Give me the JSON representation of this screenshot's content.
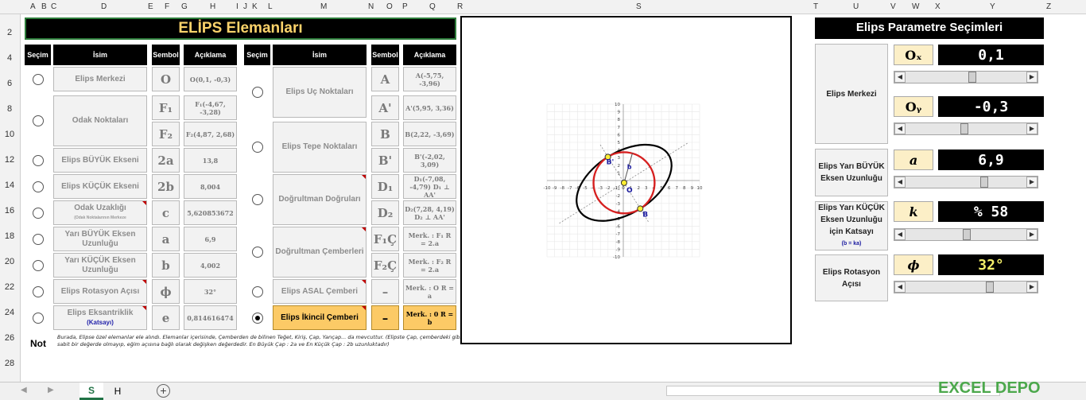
{
  "columns": [
    "A",
    "B",
    "C",
    "D",
    "E",
    "F",
    "G",
    "H",
    "I",
    "J",
    "K",
    "L",
    "M",
    "N",
    "O",
    "P",
    "Q",
    "R",
    "S",
    "T",
    "U",
    "V",
    "W",
    "X",
    "Y",
    "Z"
  ],
  "rows": [
    "2",
    "4",
    "6",
    "8",
    "10",
    "12",
    "14",
    "16",
    "18",
    "20",
    "22",
    "24",
    "26",
    "28"
  ],
  "left_title": "ELİPS Elemanları",
  "headers": {
    "secim": "Seçim",
    "isim": "İsim",
    "sembol": "Sembol",
    "aciklama": "Açıklama"
  },
  "left_items": [
    {
      "name": "Elips Merkezi",
      "symbol": "O",
      "desc": "O(0,1, -0,3)"
    },
    {
      "name": "Odak Noktaları",
      "symbol": "F₁",
      "desc": "F₁(-4,67, -3,28)"
    },
    {
      "name": "",
      "symbol": "F₂",
      "desc": "F₂(4,87, 2,68)"
    },
    {
      "name": "Elips BÜYÜK Ekseni",
      "symbol": "2a",
      "desc": "13,8"
    },
    {
      "name": "Elips KÜÇÜK Ekseni",
      "symbol": "2b",
      "desc": "8,004"
    },
    {
      "name": "Odak Uzaklığı",
      "sub": "(Odak Noktalarının Merkeze",
      "symbol": "c",
      "desc": "5,620853672"
    },
    {
      "name": "Yarı BÜYÜK Eksen Uzunluğu",
      "symbol": "a",
      "desc": "6,9"
    },
    {
      "name": "Yarı KÜÇÜK Eksen Uzunluğu",
      "symbol": "b",
      "desc": "4,002"
    },
    {
      "name": "Elips Rotasyon Açısı",
      "symbol": "ϕ",
      "desc": "32°"
    },
    {
      "name": "Elips Eksantriklik",
      "sub": "(Katsayı)",
      "symbol": "e",
      "desc": "0,814616474"
    }
  ],
  "right_items": [
    {
      "name": "Elips Uç Noktaları",
      "symbol": "A",
      "desc": "A(-5,75, -3,96)"
    },
    {
      "name": "",
      "symbol": "A'",
      "desc": "A'(5,95, 3,36)"
    },
    {
      "name": "Elips Tepe Noktaları",
      "symbol": "B",
      "desc": "B(2,22, -3,69)"
    },
    {
      "name": "",
      "symbol": "B'",
      "desc": "B'(-2,02, 3,09)"
    },
    {
      "name": "Doğrultman Doğruları",
      "symbol": "D₁",
      "desc": "D₁(-7,08, -4,79) D₁ ⊥ AA'"
    },
    {
      "name": "",
      "symbol": "D₂",
      "desc": "D₂(7,28, 4,19) D₂ ⊥ AA'"
    },
    {
      "name": "Doğrultman Çemberleri",
      "symbol": "F₁Ç",
      "desc": "Merk. : F₁ R = 2.a"
    },
    {
      "name": "",
      "symbol": "F₂Ç",
      "desc": "Merk. : F₂ R = 2.a"
    },
    {
      "name": "Elips ASAL Çemberi",
      "symbol": "–",
      "desc": "Merk. : O R = a"
    },
    {
      "name": "Elips İkincil Çemberi",
      "symbol": "–",
      "desc": "Merk. : 0 R = b"
    }
  ],
  "note_label": "Not",
  "note_text": "Burada, Elipse özel elemanlar ele alındı. Elemanlar içerisinde, Çemberden de bilinen Teğet, Kiriş, Çap, Yarıçap... da mevcuttur. (Elipste Çap, çemberdeki gibi sabit bir değerde olmayıp, eğim açısına bağlı olarak değişken değerdedir. En Büyük Çap : 2a ve En Küçük Çap : 2b uzunluktadır)",
  "chart_data": {
    "type": "scatter",
    "xlim": [
      -10,
      10
    ],
    "ylim": [
      -10,
      10
    ],
    "grid": true,
    "center": [
      0.1,
      -0.3
    ],
    "a": 6.9,
    "b": 4.002,
    "rotation_deg": 32,
    "points": [
      {
        "label": "O",
        "x": 0.1,
        "y": -0.3
      },
      {
        "label": "B",
        "x": 2.22,
        "y": -3.69
      },
      {
        "label": "B'",
        "x": -2.02,
        "y": 3.09
      }
    ],
    "vector_label": "b",
    "ticks": [
      "-10",
      "-9",
      "-8",
      "-7",
      "-6",
      "-5",
      "-4",
      "-3",
      "-2",
      "-1",
      "0",
      "1",
      "2",
      "3",
      "4",
      "5",
      "6",
      "7",
      "8",
      "9",
      "10"
    ]
  },
  "panel": {
    "title": "Elips Parametre Seçimleri",
    "groups": [
      {
        "label": "Elips Merkezi",
        "params": [
          {
            "name": "Oₓ",
            "value": "0,1",
            "pos": 0.55
          },
          {
            "name": "Oᵧ",
            "value": "-0,3",
            "pos": 0.48
          }
        ]
      },
      {
        "label": "Elips Yarı BÜYÜK Eksen Uzunluğu",
        "params": [
          {
            "name": "a",
            "value": "6,9",
            "pos": 0.65
          }
        ]
      },
      {
        "label": "Elips Yarı KÜÇÜK Eksen Uzunluğu için Katsayı",
        "sub": "(b = ka)",
        "params": [
          {
            "name": "k",
            "value": "% 58",
            "pos": 0.5
          }
        ]
      },
      {
        "label": "Elips Rotasyon Açısı",
        "params": [
          {
            "name": "ϕ",
            "value": "32°",
            "pos": 0.7
          }
        ]
      }
    ]
  },
  "sheets": [
    "S",
    "H"
  ],
  "watermark": "EXCEL DEPO"
}
